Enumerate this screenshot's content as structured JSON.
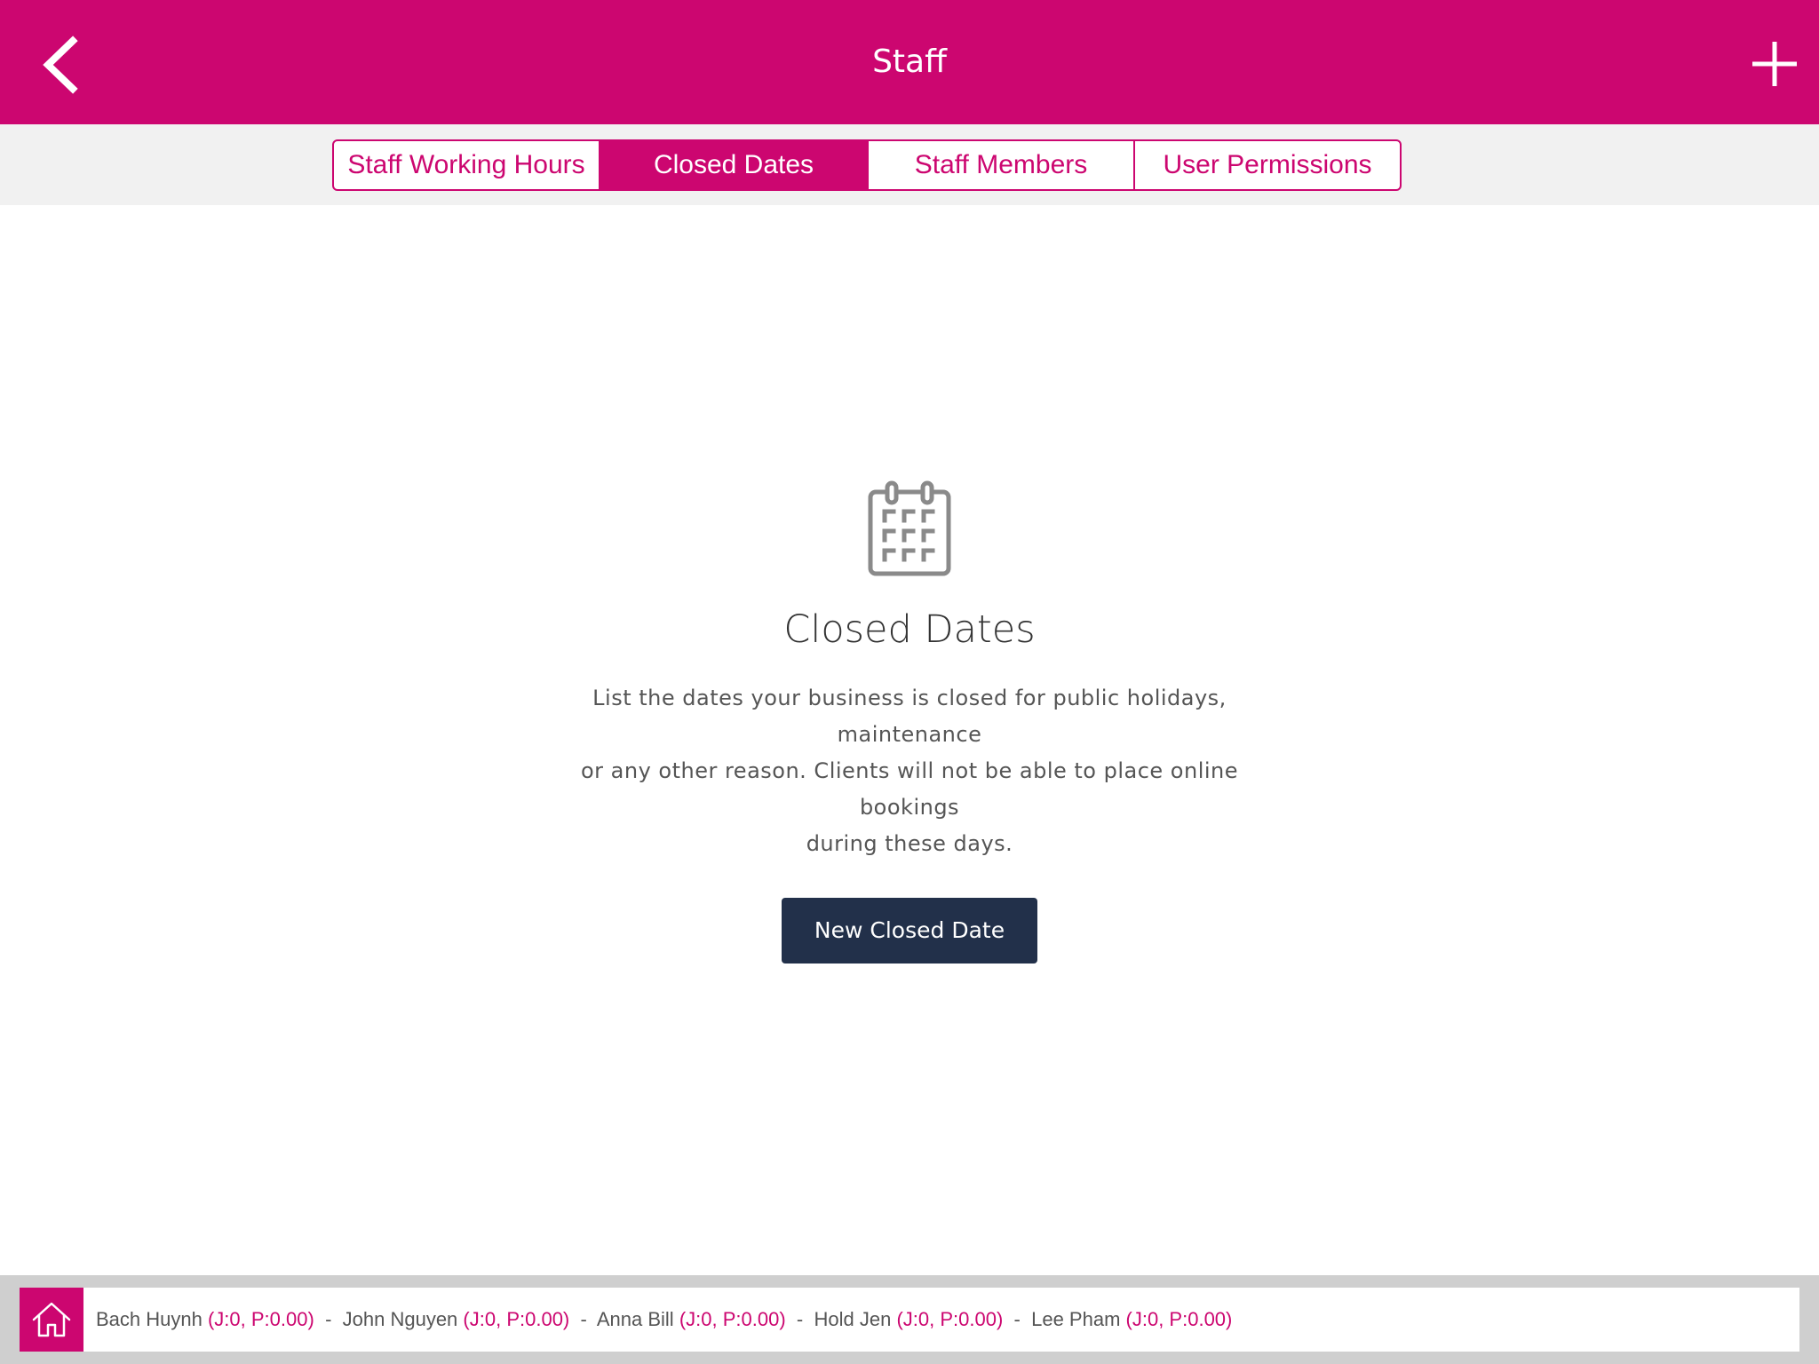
{
  "header": {
    "title": "Staff",
    "back_icon": "chevron-left-icon",
    "add_icon": "plus-icon"
  },
  "tabs": [
    {
      "label": "Staff Working Hours",
      "active": false
    },
    {
      "label": "Closed Dates",
      "active": true
    },
    {
      "label": "Staff Members",
      "active": false
    },
    {
      "label": "User Permissions",
      "active": false
    }
  ],
  "empty_state": {
    "icon": "calendar-icon",
    "title": "Closed Dates",
    "description_lines": [
      "List the dates your business is closed for public holidays, maintenance",
      "or any other reason. Clients will not be able to place online bookings",
      "during these days."
    ],
    "button_label": "New Closed Date"
  },
  "footer": {
    "home_icon": "home-icon",
    "staff": [
      {
        "name": "Bach Huynh",
        "stats": "(J:0, P:0.00)"
      },
      {
        "name": "John Nguyen",
        "stats": "(J:0, P:0.00)"
      },
      {
        "name": "Anna Bill",
        "stats": "(J:0, P:0.00)"
      },
      {
        "name": "Hold Jen",
        "stats": "(J:0, P:0.00)"
      },
      {
        "name": "Lee Pham",
        "stats": "(J:0, P:0.00)"
      }
    ],
    "separator": " - "
  },
  "colors": {
    "brand": "#cc0670",
    "button_dark": "#22304a",
    "tabs_bg": "#f1f1f1",
    "footer_bg": "#cfcfcf"
  }
}
